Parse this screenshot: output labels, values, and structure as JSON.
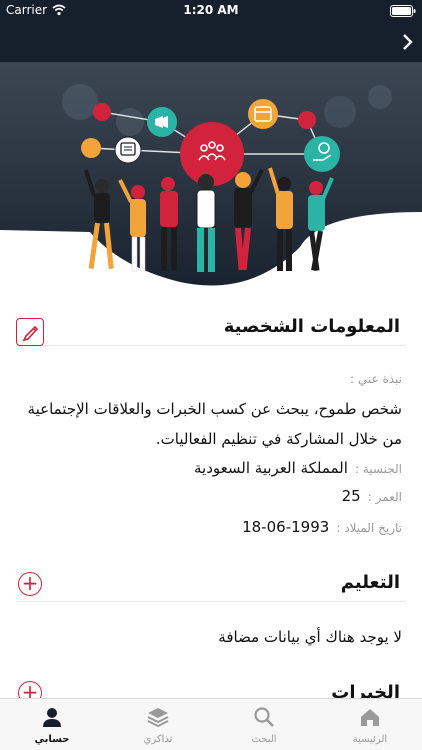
{
  "status_bar": {
    "carrier": "Carrier",
    "time": "1:20 AM"
  },
  "colors": {
    "accent": "#d2233c",
    "dark": "#16202c",
    "teal": "#2bb3a6",
    "orange": "#f2a33a",
    "blue": "#3aa8e0"
  },
  "profile": {
    "section_title": "المعلومات الشخصية",
    "about_label": "نبذة عني :",
    "bio": "شخص طموح، يبحث عن كسب الخبرات والعلاقات الإجتماعية من خلال المشاركة في تنظيم الفعاليات.",
    "nationality_label": "الجنسية :",
    "nationality": "المملكة العربية السعودية",
    "age_label": "العمر :",
    "age": "25",
    "birthdate_label": "تاريخ الميلاد :",
    "birthdate": "1993-06-18"
  },
  "education": {
    "section_title": "التعليم",
    "empty_message": "لا يوجد هناك أي بيانات مضافة"
  },
  "experience": {
    "section_title": "الخبرات"
  },
  "tabs": [
    {
      "label": "الرئيسية",
      "icon": "home-icon"
    },
    {
      "label": "البحث",
      "icon": "search-icon"
    },
    {
      "label": "تذاكري",
      "icon": "tickets-stack-icon"
    },
    {
      "label": "حسابي",
      "icon": "user-icon",
      "active": true
    }
  ]
}
